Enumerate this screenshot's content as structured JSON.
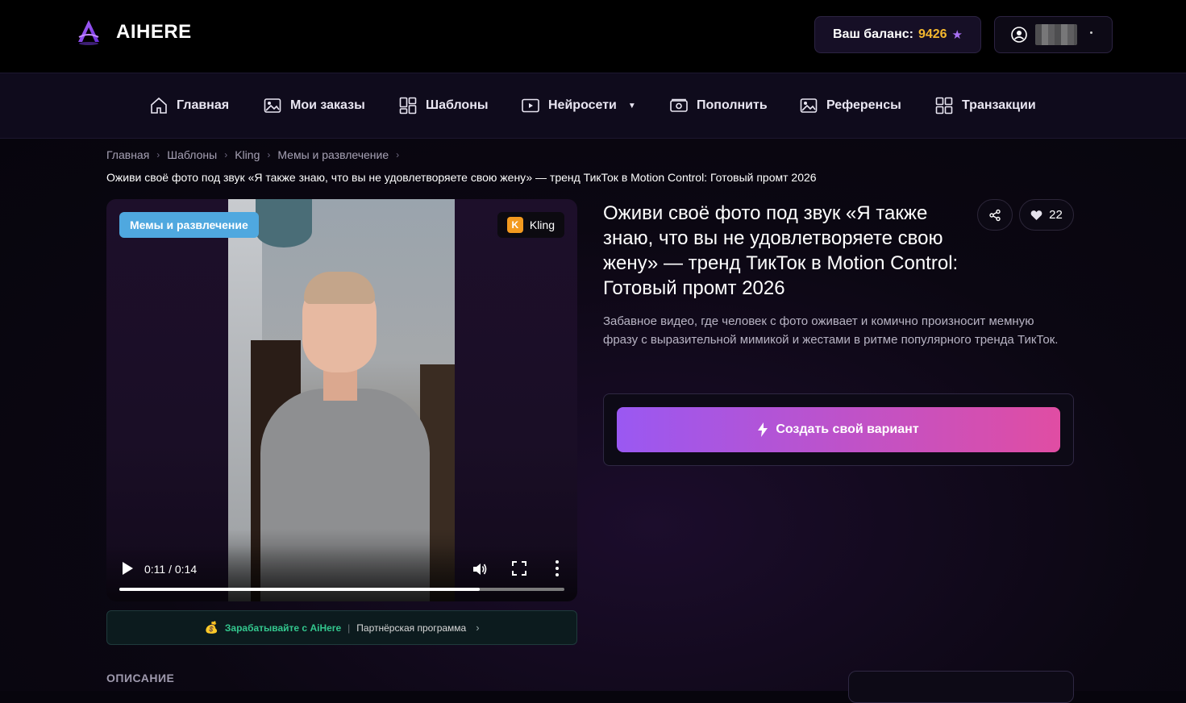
{
  "header": {
    "logo_text": "AIHERE",
    "balance_label": "Ваш баланс:",
    "balance_amount": "9426",
    "balance_star": "★"
  },
  "nav": {
    "items": [
      {
        "label": "Главная",
        "icon": "home-icon"
      },
      {
        "label": "Мои заказы",
        "icon": "image-icon"
      },
      {
        "label": "Шаблоны",
        "icon": "layout-grid-icon"
      },
      {
        "label": "Нейросети",
        "icon": "video-play-icon"
      },
      {
        "label": "Пополнить",
        "icon": "wallet-icon"
      },
      {
        "label": "Референсы",
        "icon": "image-icon"
      },
      {
        "label": "Транзакции",
        "icon": "grid-icon"
      }
    ],
    "dropdown_caret": "▼"
  },
  "breadcrumb": {
    "items": [
      "Главная",
      "Шаблоны",
      "Kling",
      "Мемы и развлечение"
    ],
    "separator": "›",
    "current": "Оживи своё фото под звук «Я также знаю, что вы не удовлетворяете свою жену» — тренд ТикТок в Motion Control: Готовый промт 2026"
  },
  "video": {
    "category_tag": "Мемы и развлечение",
    "model_initial": "K",
    "model_name": "Kling",
    "time": "0:11 / 0:14",
    "progress": 0.81
  },
  "promo": {
    "icon": "💰",
    "main": "Зарабатывайте с AiHere",
    "separator": "|",
    "sub": "Партнёрская программа",
    "chevron": "›"
  },
  "details": {
    "title": "Оживи своё фото под звук «Я также знаю, что вы не удовлетворяете свою жену» — тренд ТикТок в Motion Control: Готовый промт 2026",
    "likes": "22",
    "description": "Забавное видео, где человек с фото оживает и комично произносит мемную фразу с выразительной мимикой и жестами в ритме популярного тренда ТикТок.",
    "cta_label": "Создать свой вариант"
  },
  "section": {
    "description_heading": "ОПИСАНИЕ"
  },
  "colors": {
    "accent_start": "#9a58f2",
    "accent_end": "#e04da3",
    "balance_gold": "#f5b82e",
    "tag_blue": "#4fa8df",
    "promo_green": "#33c78e"
  }
}
